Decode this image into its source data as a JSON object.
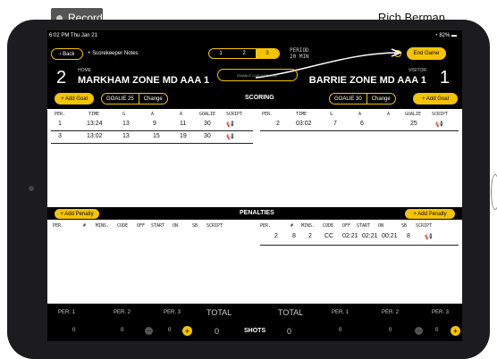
{
  "topbar": {
    "record_label": "Record",
    "user_name": "Rich Berman"
  },
  "status": {
    "time": "6:02 PM  Thu Jan 21",
    "battery": "82%"
  },
  "header": {
    "back_label": "Back",
    "notes_label": "+ Scorekeeper Notes",
    "periods": [
      "1",
      "2",
      "3"
    ],
    "active_period": "3",
    "period_title": "PERIOD",
    "period_length": "20 MIN",
    "end_game_label": "End Game",
    "enable_live_label": "ENABLE LIVE SCORING",
    "home_score": "2",
    "home_label": "HOME",
    "home_name": "MARKHAM ZONE MD AAA 1",
    "visitor_score": "1",
    "visitor_label": "VISITOR",
    "visitor_name": "BARRIE ZONE MD AAA 1"
  },
  "scoring": {
    "title": "SCORING",
    "add_goal_label": "+ Add Goal",
    "home_goalie": "GOALIE 25",
    "visitor_goalie": "GOALIE 30",
    "change_label": "Change",
    "columns": [
      "PER.",
      "TIME",
      "G",
      "A",
      "A",
      "GOALIE",
      "SCRIPT"
    ],
    "home_rows": [
      {
        "per": "1",
        "time": "13:24",
        "g": "13",
        "a1": "9",
        "a2": "11",
        "goalie": "30"
      },
      {
        "per": "3",
        "time": "13:02",
        "g": "13",
        "a1": "15",
        "a2": "19",
        "goalie": "30"
      }
    ],
    "visitor_rows": [
      {
        "per": "2",
        "time": "03:02",
        "g": "7",
        "a1": "6",
        "a2": "",
        "goalie": "25"
      }
    ]
  },
  "penalties": {
    "title": "PENALTIES",
    "add_label": "+ Add Penalty",
    "columns": [
      "PER.",
      "#",
      "MINS.",
      "CODE",
      "OFF",
      "START",
      "ON",
      "SB",
      "SCRIPT"
    ],
    "visitor_rows": [
      {
        "per": "2",
        "num": "8",
        "mins": "2",
        "code": "CC",
        "off": "02:21",
        "start": "02:21",
        "on": "00:21",
        "sb": "8"
      }
    ]
  },
  "shots": {
    "label": "SHOTS",
    "total_label": "TOTAL",
    "period_labels": [
      "PER. 1",
      "PER. 2",
      "PER. 3"
    ],
    "home": {
      "p1": "0",
      "p2": "0",
      "p3": "0",
      "total": "0"
    },
    "visitor": {
      "p1": "0",
      "p2": "0",
      "p3": "0",
      "total": "0"
    }
  },
  "colors": {
    "accent": "#f5c400",
    "header_bg": "#000000"
  }
}
